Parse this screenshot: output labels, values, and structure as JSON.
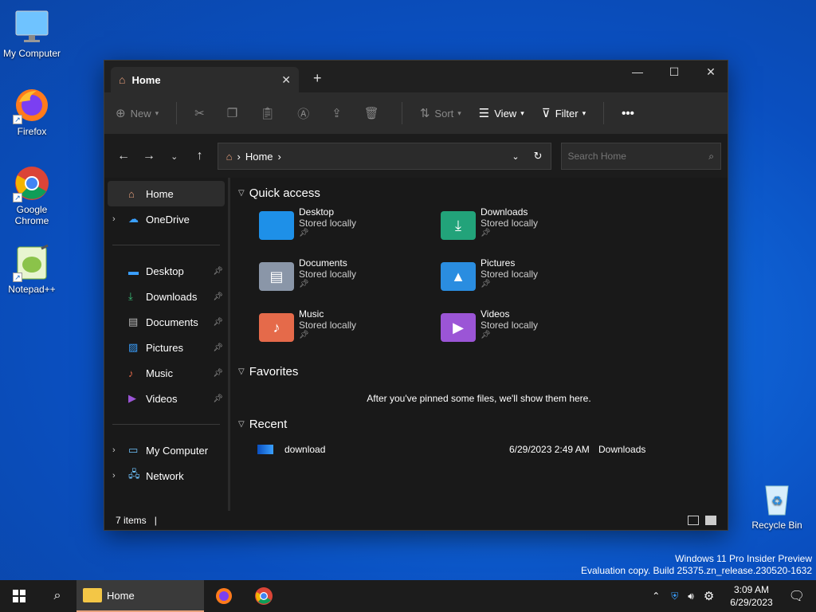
{
  "desktop": {
    "icons": [
      {
        "label": "My Computer"
      },
      {
        "label": "Firefox"
      },
      {
        "label": "Google Chrome"
      },
      {
        "label": "Notepad++"
      },
      {
        "label": "Recycle Bin"
      }
    ]
  },
  "window": {
    "tab_title": "Home",
    "toolbar": {
      "new_label": "New",
      "sort_label": "Sort",
      "view_label": "View",
      "filter_label": "Filter"
    },
    "address": {
      "path": "Home",
      "search_placeholder": "Search Home"
    },
    "sidebar": {
      "top": [
        {
          "label": "Home"
        },
        {
          "label": "OneDrive"
        }
      ],
      "pinned": [
        {
          "label": "Desktop"
        },
        {
          "label": "Downloads"
        },
        {
          "label": "Documents"
        },
        {
          "label": "Pictures"
        },
        {
          "label": "Music"
        },
        {
          "label": "Videos"
        }
      ],
      "bottom": [
        {
          "label": "My Computer"
        },
        {
          "label": "Network"
        }
      ]
    },
    "quick_access": {
      "title": "Quick access",
      "items": [
        {
          "name": "Desktop",
          "sub": "Stored locally",
          "color": "#1e90e8"
        },
        {
          "name": "Downloads",
          "sub": "Stored locally",
          "color": "#22a37a"
        },
        {
          "name": "Documents",
          "sub": "Stored locally",
          "color": "#8a96a8"
        },
        {
          "name": "Pictures",
          "sub": "Stored locally",
          "color": "#2a8de0"
        },
        {
          "name": "Music",
          "sub": "Stored locally",
          "color": "#e56a4a"
        },
        {
          "name": "Videos",
          "sub": "Stored locally",
          "color": "#9b55d6"
        }
      ]
    },
    "favorites": {
      "title": "Favorites",
      "empty_message": "After you've pinned some files, we'll show them here."
    },
    "recent": {
      "title": "Recent",
      "items": [
        {
          "name": "download",
          "date": "6/29/2023 2:49 AM",
          "location": "Downloads"
        }
      ]
    },
    "status": {
      "count": "7 items"
    }
  },
  "watermark": {
    "line1": "Windows 11 Pro Insider Preview",
    "line2": "Evaluation copy. Build 25375.zn_release.230520-1632"
  },
  "taskbar": {
    "home_label": "Home",
    "time": "3:09 AM",
    "date": "6/29/2023"
  }
}
